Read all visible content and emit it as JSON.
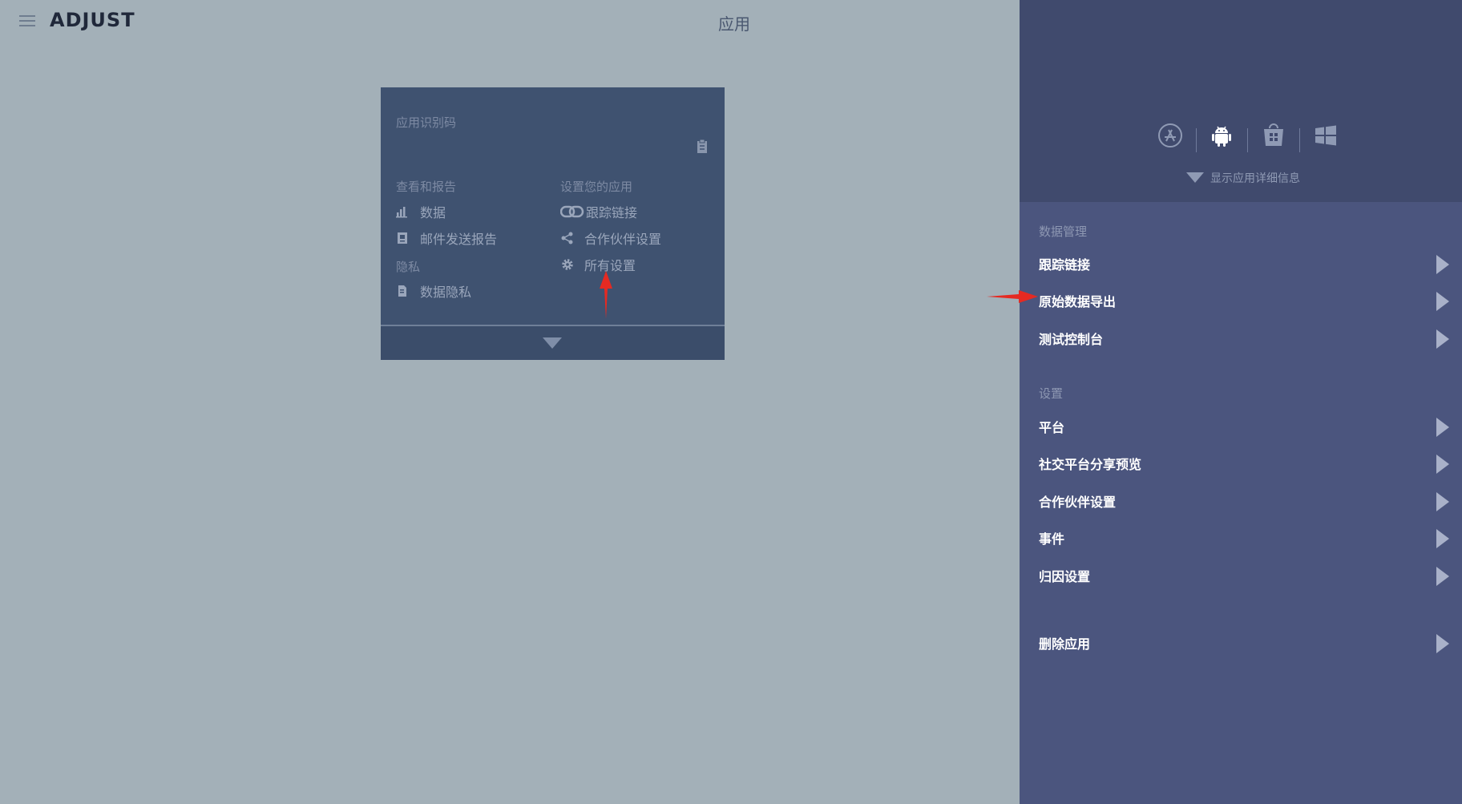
{
  "header": {
    "logo": "ADJUST",
    "page_title": "应用"
  },
  "app_card": {
    "app_id_label": "应用识别码",
    "view_report": {
      "heading": "查看和报告",
      "items": [
        {
          "label": "数据",
          "icon": "bar-chart-icon"
        },
        {
          "label": "邮件发送报告",
          "icon": "report-icon"
        }
      ]
    },
    "privacy": {
      "heading": "隐私",
      "items": [
        {
          "label": "数据隐私",
          "icon": "privacy-doc-icon"
        }
      ]
    },
    "setup_app": {
      "heading": "设置您的应用",
      "items": [
        {
          "label": "跟踪链接",
          "icon": "link-icon"
        },
        {
          "label": "合作伙伴设置",
          "icon": "share-icon"
        },
        {
          "label": "所有设置",
          "icon": "gear-icon"
        }
      ]
    }
  },
  "right_panel": {
    "platforms": [
      "app-store-icon",
      "android-icon",
      "windows-store-icon",
      "windows-icon"
    ],
    "active_platform": "android-icon",
    "show_details_label": "显示应用详细信息",
    "data_management": {
      "title": "数据管理",
      "items": [
        "跟踪链接",
        "原始数据导出",
        "测试控制台"
      ]
    },
    "settings": {
      "title": "设置",
      "items": [
        "平台",
        "社交平台分享预览",
        "合作伙伴设置",
        "事件",
        "归因设置"
      ]
    },
    "delete_app_label": "删除应用"
  },
  "colors": {
    "background": "#a3b0b8",
    "card": "#3f5270",
    "panel": "#4b557e",
    "panel_header": "#404a6d",
    "annotation_arrow": "#e52a22"
  }
}
